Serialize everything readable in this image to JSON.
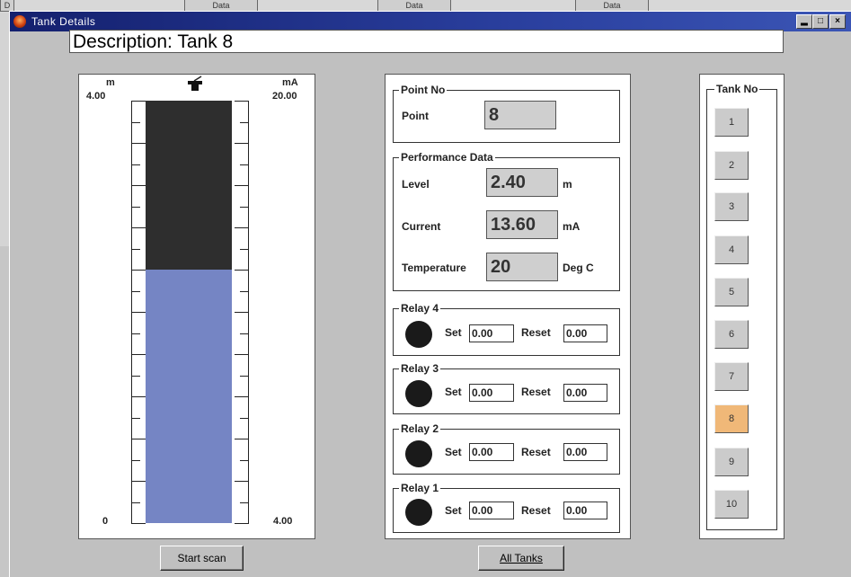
{
  "background": {
    "tabs": [
      "D",
      "Data",
      "Data",
      "Data"
    ]
  },
  "window": {
    "title": "Tank Details",
    "controls": [
      "minimize",
      "maximize",
      "close"
    ]
  },
  "description": "Description: Tank 8",
  "gauge": {
    "left_unit": "m",
    "right_unit": "mA",
    "left_top": "4.00",
    "left_bottom": "0",
    "right_top": "20.00",
    "right_bottom": "4.00",
    "level_fraction": 0.6,
    "colors": {
      "empty": "#2e2e2e",
      "fill": "#7585c4"
    }
  },
  "point": {
    "group": "Point No",
    "label": "Point",
    "value": "8"
  },
  "performance": {
    "group": "Performance Data",
    "level_label": "Level",
    "level_value": "2.40",
    "level_unit": "m",
    "current_label": "Current",
    "current_value": "13.60",
    "current_unit": "mA",
    "temp_label": "Temperature",
    "temp_value": "20",
    "temp_unit": "Deg C"
  },
  "relays": [
    {
      "name": "Relay 4",
      "set_label": "Set",
      "set": "0.00",
      "reset_label": "Reset",
      "reset": "0.00"
    },
    {
      "name": "Relay 3",
      "set_label": "Set",
      "set": "0.00",
      "reset_label": "Reset",
      "reset": "0.00"
    },
    {
      "name": "Relay 2",
      "set_label": "Set",
      "set": "0.00",
      "reset_label": "Reset",
      "reset": "0.00"
    },
    {
      "name": "Relay 1",
      "set_label": "Set",
      "set": "0.00",
      "reset_label": "Reset",
      "reset": "0.00"
    }
  ],
  "tanks": {
    "group": "Tank No",
    "items": [
      "1",
      "2",
      "3",
      "4",
      "5",
      "6",
      "7",
      "8",
      "9",
      "10"
    ],
    "selected": "8",
    "selected_color": "#f0b878"
  },
  "buttons": {
    "start_scan": "Start scan",
    "all_tanks": "All Tanks"
  }
}
